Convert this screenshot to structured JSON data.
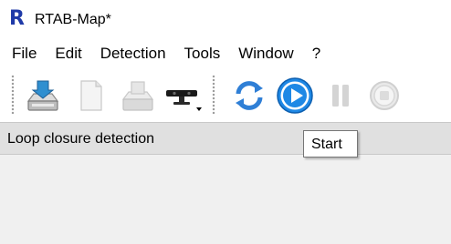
{
  "window": {
    "title": "RTAB-Map*",
    "logo_letter": "R"
  },
  "menubar": {
    "items": [
      "File",
      "Edit",
      "Detection",
      "Tools",
      "Window",
      "?"
    ]
  },
  "toolbar": {
    "buttons": [
      {
        "icon": "open-database-icon",
        "enabled": true
      },
      {
        "icon": "new-database-icon",
        "enabled": false
      },
      {
        "icon": "close-database-icon",
        "enabled": false
      },
      {
        "icon": "source-device-icon",
        "enabled": true,
        "has_dropdown": true
      },
      {
        "icon": "refresh-icon",
        "enabled": true
      },
      {
        "icon": "start-icon",
        "enabled": true,
        "hovered": true
      },
      {
        "icon": "pause-icon",
        "enabled": false
      },
      {
        "icon": "stop-icon",
        "enabled": false
      }
    ]
  },
  "panel": {
    "title": "Loop closure detection"
  },
  "tooltip": {
    "text": "Start"
  },
  "colors": {
    "logo": "#1f3aa8",
    "start_button": "#1e88e5",
    "refresh_icon": "#2f7fd6",
    "panel_header_bg": "#e0e0e0",
    "panel_body_bg": "#f0f0f0"
  }
}
